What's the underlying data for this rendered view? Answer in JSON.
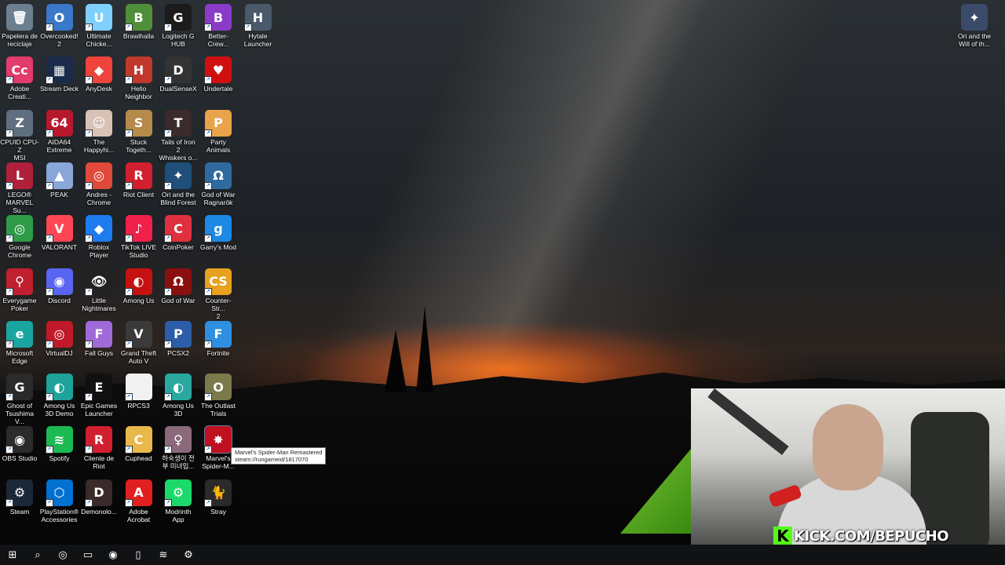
{
  "desktop": {
    "icons": [
      {
        "label": "Papelera de\nreciclaje",
        "glyph": "🗑",
        "bg": "#6b7f8f",
        "col": 0,
        "row": 0
      },
      {
        "label": "Overcooked!\n2",
        "glyph": "O",
        "bg": "#3a78c9",
        "col": 1,
        "row": 0
      },
      {
        "label": "Ultimate\nChicke...",
        "glyph": "U",
        "bg": "#7fd0ff",
        "col": 2,
        "row": 0
      },
      {
        "label": "Brawlhalla",
        "glyph": "B",
        "bg": "#4f8f3a",
        "col": 3,
        "row": 0
      },
      {
        "label": "Logitech G\nHUB",
        "glyph": "G",
        "bg": "#1b1b1b",
        "col": 4,
        "row": 0
      },
      {
        "label": "Better-Crew...",
        "glyph": "B",
        "bg": "#8a3cc9",
        "col": 5,
        "row": 0
      },
      {
        "label": "Hytale\nLauncher",
        "glyph": "H",
        "bg": "#4a5a6b",
        "col": 6,
        "row": 0
      },
      {
        "label": "Adobe\nCreati...",
        "glyph": "Cc",
        "bg": "#e33b6b",
        "col": 0,
        "row": 1
      },
      {
        "label": "Stream Deck",
        "glyph": "▦",
        "bg": "#1c2b4a",
        "col": 1,
        "row": 1
      },
      {
        "label": "AnyDesk",
        "glyph": "◆",
        "bg": "#ef443b",
        "col": 2,
        "row": 1
      },
      {
        "label": "Hello\nNeighbor",
        "glyph": "H",
        "bg": "#c0392b",
        "col": 3,
        "row": 1
      },
      {
        "label": "DualSenseX",
        "glyph": "D",
        "bg": "#333",
        "col": 4,
        "row": 1
      },
      {
        "label": "Undertale",
        "glyph": "♥",
        "bg": "#d01010",
        "col": 5,
        "row": 1
      },
      {
        "label": "CPUID CPU-Z\nMSI",
        "glyph": "Z",
        "bg": "#5f6f7f",
        "col": 0,
        "row": 2
      },
      {
        "label": "AIDA64\nExtreme",
        "glyph": "64",
        "bg": "#b7182c",
        "col": 1,
        "row": 2
      },
      {
        "label": "The\nHappyhi...",
        "glyph": "☺",
        "bg": "#d8c2b6",
        "col": 2,
        "row": 2
      },
      {
        "label": "Stuck\nTogeth...",
        "glyph": "S",
        "bg": "#b58a4b",
        "col": 3,
        "row": 2
      },
      {
        "label": "Tails of Iron 2\nWhiskers o...",
        "glyph": "T",
        "bg": "#3b2b2b",
        "col": 4,
        "row": 2
      },
      {
        "label": "Party\nAnimals",
        "glyph": "P",
        "bg": "#e9a34a",
        "col": 5,
        "row": 2
      },
      {
        "label": "LEGO®\nMARVEL Su...",
        "glyph": "L",
        "bg": "#b0203a",
        "col": 0,
        "row": 3
      },
      {
        "label": "PEAK",
        "glyph": "▲",
        "bg": "#8aa7d9",
        "col": 1,
        "row": 3
      },
      {
        "label": "Andres -\nChrome",
        "glyph": "◎",
        "bg": "#e04a3a",
        "col": 2,
        "row": 3
      },
      {
        "label": "Riot Client",
        "glyph": "R",
        "bg": "#d0202f",
        "col": 3,
        "row": 3
      },
      {
        "label": "Ori and the\nBlind Forest",
        "glyph": "✦",
        "bg": "#1f4f7a",
        "col": 4,
        "row": 3
      },
      {
        "label": "God of War\nRagnarök",
        "glyph": "Ω",
        "bg": "#2f6a9f",
        "col": 5,
        "row": 3
      },
      {
        "label": "Google\nChrome",
        "glyph": "◎",
        "bg": "#2e9b48",
        "col": 0,
        "row": 4
      },
      {
        "label": "VALORANT",
        "glyph": "V",
        "bg": "#ff4655",
        "col": 1,
        "row": 4
      },
      {
        "label": "Roblox Player",
        "glyph": "◆",
        "bg": "#1e7cf0",
        "col": 2,
        "row": 4
      },
      {
        "label": "TikTok LIVE\nStudio",
        "glyph": "♪",
        "bg": "#f0204b",
        "col": 3,
        "row": 4
      },
      {
        "label": "CoinPoker",
        "glyph": "C",
        "bg": "#e03040",
        "col": 4,
        "row": 4
      },
      {
        "label": "Garry's Mod",
        "glyph": "g",
        "bg": "#1e88e5",
        "col": 5,
        "row": 4
      },
      {
        "label": "Everygame\nPoker",
        "glyph": "⚲",
        "bg": "#c02030",
        "col": 0,
        "row": 5
      },
      {
        "label": "Discord",
        "glyph": "◉",
        "bg": "#5865f2",
        "col": 1,
        "row": 5
      },
      {
        "label": "Little\nNightmares",
        "glyph": "👁",
        "bg": "#222",
        "col": 2,
        "row": 5
      },
      {
        "label": "Among Us",
        "glyph": "◐",
        "bg": "#c51111",
        "col": 3,
        "row": 5
      },
      {
        "label": "God of War",
        "glyph": "Ω",
        "bg": "#8a1010",
        "col": 4,
        "row": 5
      },
      {
        "label": "Counter-Str...\n2",
        "glyph": "CS",
        "bg": "#e7a11f",
        "col": 5,
        "row": 5
      },
      {
        "label": "Microsoft\nEdge",
        "glyph": "e",
        "bg": "#1ba5a0",
        "col": 0,
        "row": 6
      },
      {
        "label": "VirtualDJ",
        "glyph": "◎",
        "bg": "#c01a2a",
        "col": 1,
        "row": 6
      },
      {
        "label": "Fall Guys",
        "glyph": "F",
        "bg": "#a06ad8",
        "col": 2,
        "row": 6
      },
      {
        "label": "Grand Theft\nAuto V",
        "glyph": "V",
        "bg": "#3a3a3a",
        "col": 3,
        "row": 6
      },
      {
        "label": "PCSX2",
        "glyph": "P",
        "bg": "#2d5da8",
        "col": 4,
        "row": 6
      },
      {
        "label": "Fortnite",
        "glyph": "F",
        "bg": "#2f8fe0",
        "col": 5,
        "row": 6
      },
      {
        "label": "Ghost of\nTsushima V...",
        "glyph": "G",
        "bg": "#2b2b2b",
        "col": 0,
        "row": 7
      },
      {
        "label": "Among Us\n3D Demo",
        "glyph": "◐",
        "bg": "#1fa29a",
        "col": 1,
        "row": 7
      },
      {
        "label": "Epic Games\nLauncher",
        "glyph": "E",
        "bg": "#111",
        "col": 2,
        "row": 7
      },
      {
        "label": "RPCS3",
        "glyph": " ",
        "bg": "#f2f2f2",
        "col": 3,
        "row": 7
      },
      {
        "label": "Among Us\n3D",
        "glyph": "◐",
        "bg": "#2aa8a0",
        "col": 4,
        "row": 7
      },
      {
        "label": "The Outlast\nTrials",
        "glyph": "O",
        "bg": "#7a7a4a",
        "col": 5,
        "row": 7
      },
      {
        "label": "OBS Studio",
        "glyph": "◉",
        "bg": "#2b2b2b",
        "col": 0,
        "row": 8
      },
      {
        "label": "Spotify",
        "glyph": "≋",
        "bg": "#1db954",
        "col": 1,
        "row": 8
      },
      {
        "label": "Cliente de\nRiot",
        "glyph": "R",
        "bg": "#d0202f",
        "col": 2,
        "row": 8
      },
      {
        "label": "Cuphead",
        "glyph": "C",
        "bg": "#e8b84a",
        "col": 3,
        "row": 8
      },
      {
        "label": "하숙생이 전\n부 미녀입...",
        "glyph": "♀",
        "bg": "#8a6a7a",
        "col": 4,
        "row": 8
      },
      {
        "label": "Marvel's\nSpider-M...",
        "glyph": "✸",
        "bg": "#c01020",
        "col": 5,
        "row": 8,
        "selected": true
      },
      {
        "label": "Steam",
        "glyph": "⚙",
        "bg": "#1b2838",
        "col": 0,
        "row": 9
      },
      {
        "label": "PlayStation®\nAccessories",
        "glyph": "⬡",
        "bg": "#0070d1",
        "col": 1,
        "row": 9
      },
      {
        "label": "Demonolo...",
        "glyph": "D",
        "bg": "#3a2a2a",
        "col": 2,
        "row": 9
      },
      {
        "label": "Adobe\nAcrobat",
        "glyph": "A",
        "bg": "#e02020",
        "col": 3,
        "row": 9
      },
      {
        "label": "Modrinth\nApp",
        "glyph": "⚙",
        "bg": "#1bd96a",
        "col": 4,
        "row": 9
      },
      {
        "label": "Stray",
        "glyph": "🐈",
        "bg": "#2a2a2a",
        "col": 5,
        "row": 9
      }
    ],
    "right_icon": {
      "label": "Ori and the\nWill of th...",
      "glyph": "✦",
      "bg": "#3a4a6a"
    }
  },
  "tooltip": {
    "text": "Marvel's Spider-Man Remastered\nsteam://rungameid/1817070"
  },
  "taskbar": {
    "items": [
      {
        "name": "start-icon",
        "glyph": "⊞"
      },
      {
        "name": "search-icon",
        "glyph": "⌕"
      },
      {
        "name": "chrome-icon",
        "glyph": "◎"
      },
      {
        "name": "file-explorer-icon",
        "glyph": "▭"
      },
      {
        "name": "obs-icon",
        "glyph": "◉"
      },
      {
        "name": "notepad-icon",
        "glyph": "▯"
      },
      {
        "name": "spotify-icon",
        "glyph": "≋"
      },
      {
        "name": "steam-icon",
        "glyph": "⚙"
      }
    ]
  },
  "overlay": {
    "kick_letter": "K",
    "kick_text": "KICK.COM/BEPUCHO",
    "kick_color": "#53fc18"
  }
}
